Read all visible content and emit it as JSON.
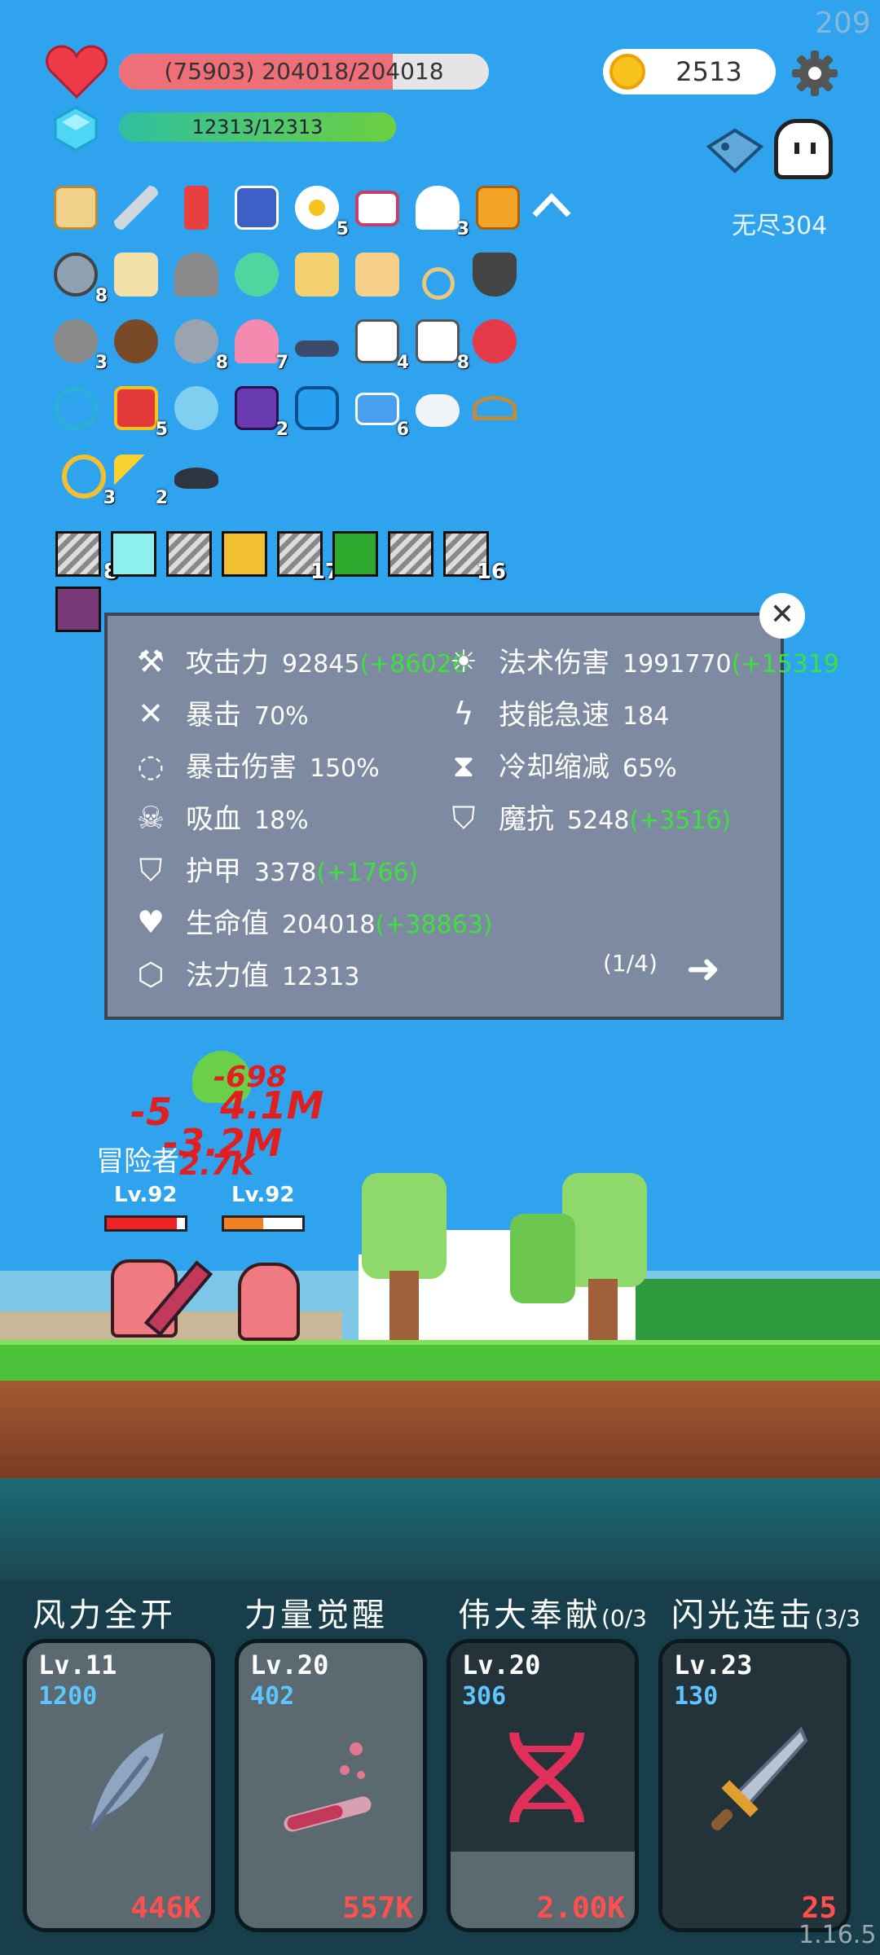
{
  "hud": {
    "hp_text": "(75903) 204018/204018",
    "mp_text": "12313/12313",
    "coins": "2513",
    "fps": "209",
    "mode_label": "无尽304"
  },
  "inventory": {
    "counts": {
      "egg": "5",
      "ghost": "3",
      "compass": "8",
      "mace": "3",
      "meteor": "8",
      "icecream": "7",
      "dice": "4",
      "cards": "8",
      "gift": "5",
      "chest": "2",
      "ticket": "6",
      "ring": "3",
      "wand": "2"
    },
    "equip_counts": {
      "blade4": "17",
      "blade6": "16",
      "blade1": "8"
    }
  },
  "stats": {
    "rows": [
      {
        "label": "攻击力",
        "value": "92845",
        "bonus": "(+86026"
      },
      {
        "label": "暴击",
        "value": "70%"
      },
      {
        "label": "暴击伤害",
        "value": "150%"
      },
      {
        "label": "吸血",
        "value": "18%"
      },
      {
        "label": "护甲",
        "value": "3378",
        "bonus": "(+1766)"
      },
      {
        "label": "生命值",
        "value": "204018",
        "bonus": "(+38863)"
      },
      {
        "label": "法力值",
        "value": "12313"
      }
    ],
    "rows_right": [
      {
        "label": "法术伤害",
        "value": "1991770",
        "bonus": "(+15319"
      },
      {
        "label": "技能急速",
        "value": "184"
      },
      {
        "label": "冷却缩减",
        "value": "65%"
      },
      {
        "label": "魔抗",
        "value": "5248",
        "bonus": "(+3516)"
      }
    ],
    "page": "(1/4)"
  },
  "battle": {
    "adventurer_label": "冒险者",
    "hero_level": "Lv.92",
    "enemy_level": "Lv.92",
    "hero_hp_fraction": 0.9,
    "enemy_hp_fraction": 0.5,
    "damage_numbers": [
      "-5",
      "4.1M",
      "-3.2M",
      "2.7K",
      "-698"
    ]
  },
  "skills": [
    {
      "name": "风力全开",
      "level": "Lv.11",
      "mana": "1200",
      "cost": "446K",
      "icon": "feather-icon"
    },
    {
      "name": "力量觉醒",
      "level": "Lv.20",
      "mana": "402",
      "cost": "557K",
      "icon": "potion-icon"
    },
    {
      "name": "伟大奉献",
      "count": "(0/3",
      "level": "Lv.20",
      "mana": "306",
      "cost": "2.00K",
      "icon": "dna-icon"
    },
    {
      "name": "闪光连击",
      "count": "(3/3",
      "level": "Lv.23",
      "mana": "130",
      "cost": "25",
      "icon": "sword-icon"
    }
  ],
  "version": "1.16.5",
  "colors": {
    "sky": "#2fa3ee",
    "hp": "#ef6f78",
    "bonus": "#3de03d",
    "cost": "#ff5050",
    "mana": "#5ec6ff"
  }
}
